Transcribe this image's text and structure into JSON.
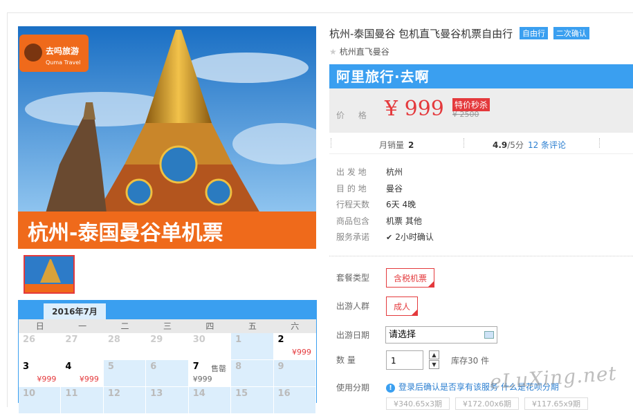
{
  "product": {
    "title": "杭州-泰国曼谷 包机直飞曼谷机票自由行",
    "badges": [
      "自由行",
      "二次确认"
    ],
    "subtitle": "杭州直飞曼谷",
    "hero_caption": "杭州-泰国曼谷单机票",
    "hero_logo_cn": "去吗旅游",
    "hero_logo_en": "Quma Travel"
  },
  "brand": {
    "name": "阿里旅行·去啊",
    "color": "#3a9ff0"
  },
  "price": {
    "label": "价 格",
    "current": "¥ 999",
    "flash_tag": "特价秒杀",
    "original": "¥ 2500"
  },
  "stats": {
    "monthly_sales_label": "月销量",
    "monthly_sales": "2",
    "rating": "4.9",
    "rating_suffix": "/5分",
    "reviews": "12 条评论"
  },
  "info": [
    {
      "key": "出 发 地",
      "value": "杭州"
    },
    {
      "key": "目 的 地",
      "value": "曼谷"
    },
    {
      "key": "行程天数",
      "value": "6天 4晚"
    },
    {
      "key": "商品包含",
      "value": "机票 其他"
    },
    {
      "key": "服务承诺",
      "value": "2小时确认"
    }
  ],
  "options": {
    "package_label": "套餐类型",
    "package_value": "含税机票",
    "crowd_label": "出游人群",
    "crowd_value": "成人",
    "date_label": "出游日期",
    "date_placeholder": "请选择",
    "qty_label": "数 量",
    "qty_value": "1",
    "stock": "库存30 件",
    "installment_label": "使用分期",
    "installment_text": "登录后确认是否享有该服务",
    "installment_link": "什么是花呗分期",
    "plans": [
      "¥340.65x3期",
      "¥172.00x6期",
      "¥117.65x9期"
    ]
  },
  "calendar": {
    "month": "2016年7月",
    "weekdays": [
      "日",
      "一",
      "二",
      "三",
      "四",
      "五",
      "六"
    ],
    "rows": [
      [
        {
          "d": "26",
          "type": "past"
        },
        {
          "d": "27",
          "type": "past"
        },
        {
          "d": "28",
          "type": "past"
        },
        {
          "d": "29",
          "type": "past"
        },
        {
          "d": "30",
          "type": "past"
        },
        {
          "d": "1",
          "type": "future"
        },
        {
          "d": "2",
          "type": "avail",
          "p": "¥999"
        }
      ],
      [
        {
          "d": "3",
          "type": "avail",
          "p": "¥999"
        },
        {
          "d": "4",
          "type": "avail",
          "p": "¥999"
        },
        {
          "d": "5",
          "type": "future"
        },
        {
          "d": "6",
          "type": "future"
        },
        {
          "d": "7",
          "type": "avail",
          "p": "¥999",
          "tag": "售罄"
        },
        {
          "d": "8",
          "type": "future"
        },
        {
          "d": "9",
          "type": "future"
        }
      ],
      [
        {
          "d": "10",
          "type": "future"
        },
        {
          "d": "11",
          "type": "future"
        },
        {
          "d": "12",
          "type": "future"
        },
        {
          "d": "13",
          "type": "future"
        },
        {
          "d": "14",
          "type": "future"
        },
        {
          "d": "15",
          "type": "future"
        },
        {
          "d": "16",
          "type": "future"
        }
      ]
    ]
  },
  "watermark": "eLuXing.net"
}
